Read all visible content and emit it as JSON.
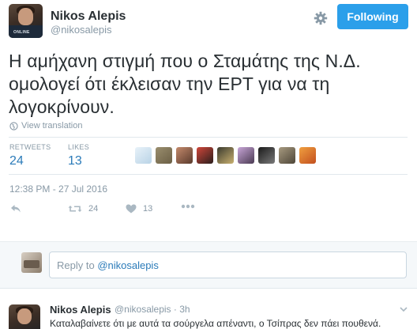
{
  "tweet": {
    "author_name": "Nikos Alepis",
    "author_handle": "@nikosalepis",
    "avatar_shirt_text": "ONLINE",
    "follow_label": "Following",
    "text": "Η αμήχανη στιγμή που ο Σταμάτης της Ν.Δ. ομολογεί ότι έκλεισαν την ΕΡΤ για να τη λογοκρίνουν.",
    "translate_label": "View translation",
    "retweets_label": "RETWEETS",
    "retweets_count": "24",
    "likes_label": "LIKES",
    "likes_count": "13",
    "timestamp": "12:38 PM - 27 Jul 2016",
    "actions": {
      "reply_icon": "reply-icon",
      "retweet_icon": "retweet-icon",
      "retweet_count": "24",
      "like_icon": "heart-icon",
      "like_count": "13",
      "more_icon": "more-dots-icon"
    },
    "liker_avatars": [
      {
        "name": "liker-avatar-1",
        "colors": [
          "#e8f2f9",
          "#b9d3e6"
        ]
      },
      {
        "name": "liker-avatar-2",
        "colors": [
          "#9a8e6e",
          "#6b5f45"
        ]
      },
      {
        "name": "liker-avatar-3",
        "colors": [
          "#c48a6c",
          "#5a3a2c"
        ]
      },
      {
        "name": "liker-avatar-4",
        "colors": [
          "#d0463a",
          "#2a1e1c"
        ]
      },
      {
        "name": "liker-avatar-5",
        "colors": [
          "#3a3a2e",
          "#c9b070"
        ]
      },
      {
        "name": "liker-avatar-6",
        "colors": [
          "#c7a5d6",
          "#4a3a52"
        ]
      },
      {
        "name": "liker-avatar-7",
        "colors": [
          "#1a1a1a",
          "#7a7a7a"
        ]
      },
      {
        "name": "liker-avatar-8",
        "colors": [
          "#a79a80",
          "#4e4638"
        ]
      },
      {
        "name": "liker-avatar-9",
        "colors": [
          "#f0a040",
          "#c24f1e"
        ]
      }
    ]
  },
  "reply_box": {
    "placeholder_prefix": "Reply to ",
    "placeholder_handle": "@nikosalepis"
  },
  "reply_tweet": {
    "author_name": "Nikos Alepis",
    "meta": "@nikosalepis · 3h",
    "text": "Καταλαβαίνετε ότι με αυτά τα σούργελα απέναντι, ο Τσίπρας δεν πάει πουθενά."
  },
  "colors": {
    "accent": "#2b9fea",
    "link": "#2b7bb9",
    "muted": "#8899a6",
    "text": "#292f33"
  }
}
